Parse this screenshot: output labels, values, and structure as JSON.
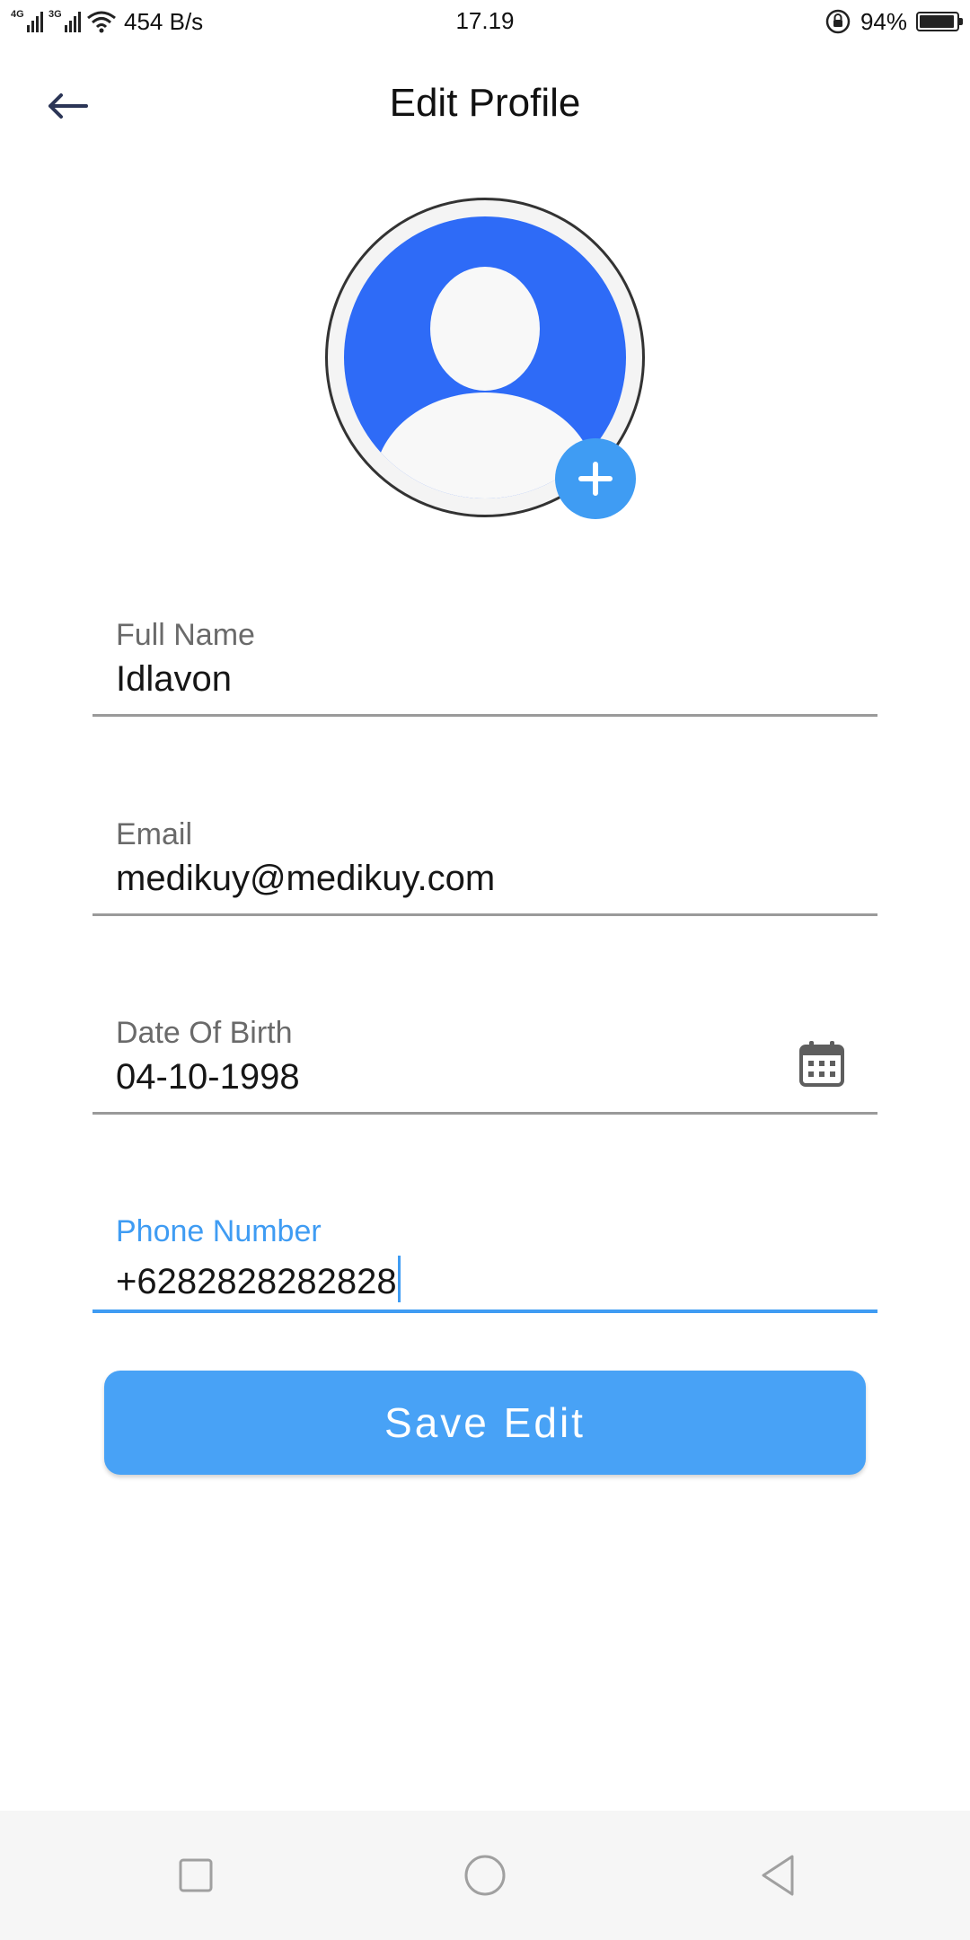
{
  "status_bar": {
    "network_left": "4G",
    "network_right": "3G",
    "speed": "454 B/s",
    "time": "17.19",
    "battery": "94%",
    "battery_level": 0.94
  },
  "header": {
    "title": "Edit Profile",
    "back_icon": "arrow-left-icon"
  },
  "avatar": {
    "add_icon": "plus-icon",
    "accent_color": "#2e6bf7"
  },
  "form": {
    "full_name": {
      "label": "Full Name",
      "value": "Idlavon"
    },
    "email": {
      "label": "Email",
      "value": "medikuy@medikuy.com"
    },
    "date_of_birth": {
      "label": "Date Of Birth",
      "value": "04-10-1998",
      "icon": "calendar-icon"
    },
    "phone_number": {
      "label": "Phone Number",
      "value": "+6282828282828"
    }
  },
  "save_label": "Save Edit",
  "colors": {
    "primary": "#48a2f6",
    "focus": "#3f9cf3"
  },
  "nav": {
    "recent_icon": "square-icon",
    "home_icon": "circle-icon",
    "back_icon": "triangle-back-icon"
  }
}
